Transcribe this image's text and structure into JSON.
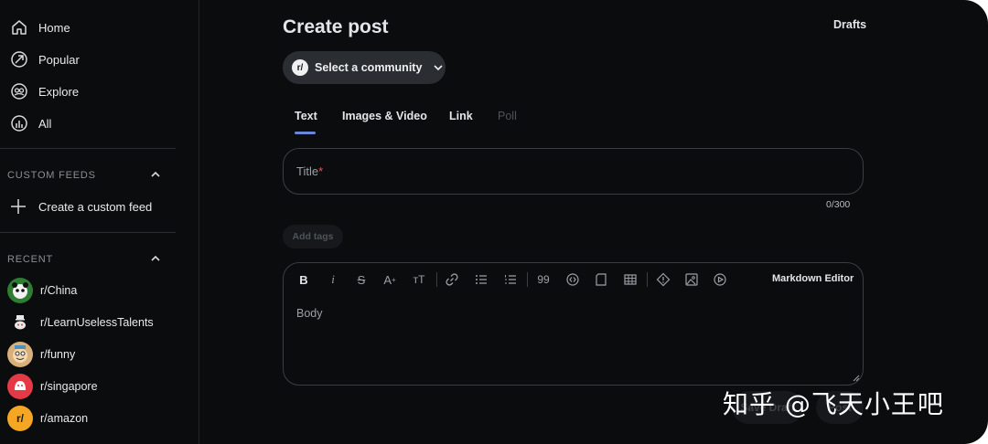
{
  "sidebar": {
    "nav": [
      {
        "label": "Home",
        "icon": "home-icon"
      },
      {
        "label": "Popular",
        "icon": "popular-icon"
      },
      {
        "label": "Explore",
        "icon": "explore-icon"
      },
      {
        "label": "All",
        "icon": "all-icon"
      }
    ],
    "custom_feeds": {
      "title": "CUSTOM FEEDS",
      "create_label": "Create a custom feed"
    },
    "recent": {
      "title": "RECENT",
      "items": [
        {
          "label": "r/China",
          "avatar_color": "#2e7d32"
        },
        {
          "label": "r/LearnUselessTalents",
          "avatar_color": "#0b0c0e"
        },
        {
          "label": "r/funny",
          "avatar_color": "#d9b07a"
        },
        {
          "label": "r/singapore",
          "avatar_color": "#e53945"
        },
        {
          "label": "r/amazon",
          "avatar_color": "#f5a623"
        }
      ]
    }
  },
  "main": {
    "title": "Create post",
    "drafts_label": "Drafts",
    "community_select": {
      "badge": "r/",
      "label": "Select a community"
    },
    "tabs": [
      {
        "label": "Text",
        "active": true,
        "disabled": false
      },
      {
        "label": "Images & Video",
        "active": false,
        "disabled": false
      },
      {
        "label": "Link",
        "active": false,
        "disabled": false
      },
      {
        "label": "Poll",
        "active": false,
        "disabled": true
      }
    ],
    "title_field": {
      "placeholder": "Title",
      "required_mark": "*",
      "counter": "0/300"
    },
    "tags_button": "Add tags",
    "editor": {
      "toolbar": [
        "bold",
        "italic",
        "strikethrough",
        "superscript",
        "heading",
        "link",
        "bulleted-list",
        "numbered-list",
        "quote",
        "code",
        "code-block",
        "table",
        "spoiler",
        "image",
        "video"
      ],
      "markdown_label": "Markdown Editor",
      "body_placeholder": "Body"
    },
    "buttons": {
      "save_draft": "Save Draft",
      "post": "Post"
    }
  },
  "watermark": "知乎 @飞天小王吧",
  "colors": {
    "background": "#0b0c0e",
    "accent_tab": "#6a86d6",
    "required": "#ff4d4d"
  }
}
